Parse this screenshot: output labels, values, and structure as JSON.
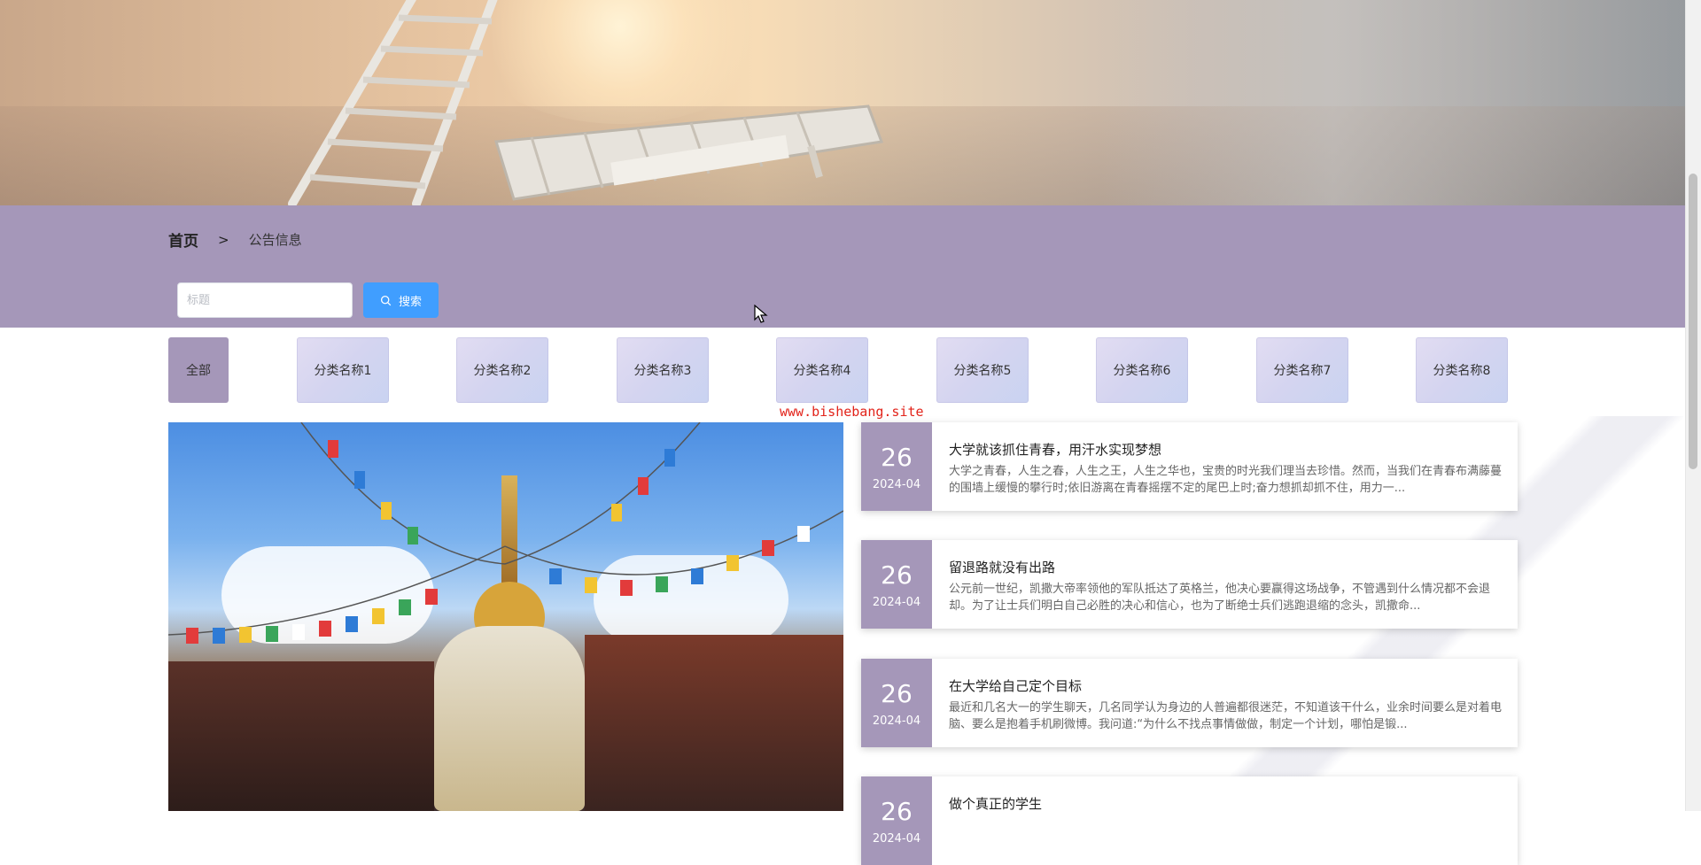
{
  "breadcrumb": {
    "home": "首页",
    "separator": ">",
    "current": "公告信息"
  },
  "search": {
    "placeholder": "标题",
    "button_label": "搜索"
  },
  "categories": [
    {
      "label": "全部",
      "active": true
    },
    {
      "label": "分类名称1"
    },
    {
      "label": "分类名称2"
    },
    {
      "label": "分类名称3"
    },
    {
      "label": "分类名称4"
    },
    {
      "label": "分类名称5"
    },
    {
      "label": "分类名称6"
    },
    {
      "label": "分类名称7"
    },
    {
      "label": "分类名称8"
    }
  ],
  "watermark": "www.bishebang.site",
  "notices": [
    {
      "day": "26",
      "year_month": "2024-04",
      "title": "大学就该抓住青春，用汗水实现梦想",
      "desc": "大学之青春，人生之春，人生之王，人生之华也，宝贵的时光我们理当去珍惜。然而，当我们在青春布满藤蔓的围墙上缓慢的攀行时;依旧游离在青春摇摆不定的尾巴上时;奋力想抓却抓不住，用力一..."
    },
    {
      "day": "26",
      "year_month": "2024-04",
      "title": "留退路就没有出路",
      "desc": "公元前一世纪，凯撒大帝率领他的军队抵达了英格兰，他决心要赢得这场战争，不管遇到什么情况都不会退却。为了让士兵们明白自己必胜的决心和信心，也为了断绝士兵们逃跑退缩的念头，凯撒命..."
    },
    {
      "day": "26",
      "year_month": "2024-04",
      "title": "在大学给自己定个目标",
      "desc": "最近和几名大一的学生聊天，几名同学认为身边的人普遍都很迷茫，不知道该干什么，业余时间要么是对着电脑、要么是抱着手机刷微博。我问道:“为什么不找点事情做做，制定一个计划，哪怕是锻..."
    },
    {
      "day": "26",
      "year_month": "2024-04",
      "title": "做个真正的学生",
      "desc": ""
    }
  ],
  "colors": {
    "accent_purple": "#a597b9",
    "search_blue": "#409eff",
    "watermark_red": "#e2231a"
  }
}
